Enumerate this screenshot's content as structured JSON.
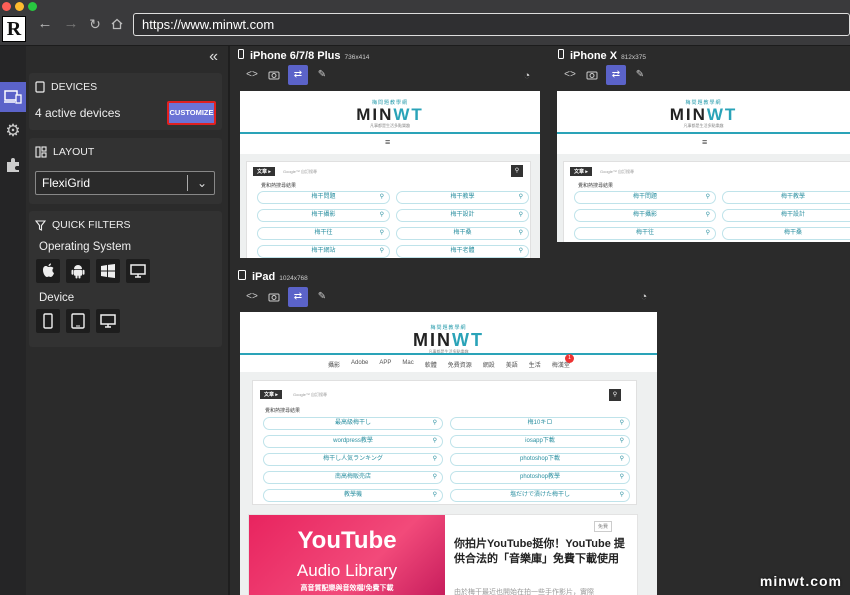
{
  "browser": {
    "url": "https://www.minwt.com",
    "logo_letter": "R"
  },
  "sidebar": {
    "devices": {
      "title": "DEVICES",
      "active_text": "4 active devices",
      "customize_label": "CUSTOMIZE"
    },
    "layout": {
      "title": "LAYOUT",
      "selected": "FlexiGrid"
    },
    "quick_filters": {
      "title": "QUICK FILTERS",
      "os_label": "Operating System",
      "device_label": "Device"
    }
  },
  "devices": [
    {
      "name": "iPhone 6/7/8 Plus",
      "dims": "736x414"
    },
    {
      "name": "iPhone X",
      "dims": "812x375"
    },
    {
      "name": "iPad",
      "dims": "1024x768"
    }
  ],
  "site": {
    "logo_top": "梅問題教學網",
    "logo_main_a": "MIN",
    "logo_main_b": "WT",
    "logo_sub": "凡事都是生活多點樂趣",
    "search_tag": "文章 ▸",
    "search_placeholder": "Google™ 自訂搜尋",
    "popular_label": "覺和熱搜尋結果",
    "pills_phone": [
      "梅干問題",
      "梅干教學",
      "梅干攝影",
      "梅干設計",
      "梅干往",
      "梅干桑",
      "梅干網站",
      "梅干老體"
    ],
    "nav": [
      "攝影",
      "Adobe",
      "APP",
      "Mac",
      "軟體",
      "免費資源",
      "網設",
      "美語",
      "生活",
      "梅漢堂"
    ],
    "nav_badge": "1",
    "pills_ipad": [
      "最高級梅干し",
      "梅10キロ",
      "wordpress教學",
      "iosapp下載",
      "梅干し人気ランキング",
      "photoshop下載",
      "南高梅販売店",
      "photoshop教學",
      "教學機",
      "塩だけで漬けた梅干し"
    ],
    "post": {
      "img_title": "YouTube",
      "img_sub": "Audio Library",
      "img_caption": "高音質配樂與音效檔/免費下載",
      "tag": "免費",
      "title": "你拍片YouTube挺你！YouTube 提供合法的「音樂庫」免費下載使用",
      "excerpt": "由於梅干最近也開始在拍一些手作影片，實際"
    }
  },
  "watermark": "minwt.com"
}
